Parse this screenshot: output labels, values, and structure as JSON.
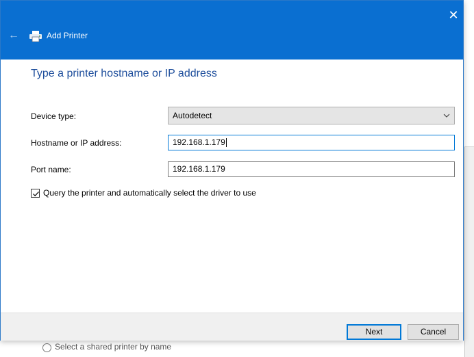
{
  "background": {
    "partial_option_label": "Select a shared printer by name"
  },
  "dialog": {
    "title": "Add Printer",
    "close_glyph": "✕",
    "back_glyph": "←",
    "heading": "Type a printer hostname or IP address",
    "device_type": {
      "label": "Device type:",
      "value": "Autodetect"
    },
    "hostname": {
      "label": "Hostname or IP address:",
      "value": "192.168.1.179"
    },
    "port": {
      "label": "Port name:",
      "value": "192.168.1.179"
    },
    "query_checkbox": {
      "label": "Query the printer and automatically select the driver to use",
      "checked": true
    },
    "buttons": {
      "next": "Next",
      "cancel": "Cancel"
    }
  },
  "colors": {
    "titlebar": "#0a6fd1",
    "heading": "#1e4e9c",
    "focus_border": "#0078d7"
  },
  "icons": {
    "back": "arrow-left-icon",
    "close": "close-icon",
    "printer": "printer-icon",
    "dropdown": "chevron-down-icon",
    "checkmark": "checkmark-icon"
  }
}
